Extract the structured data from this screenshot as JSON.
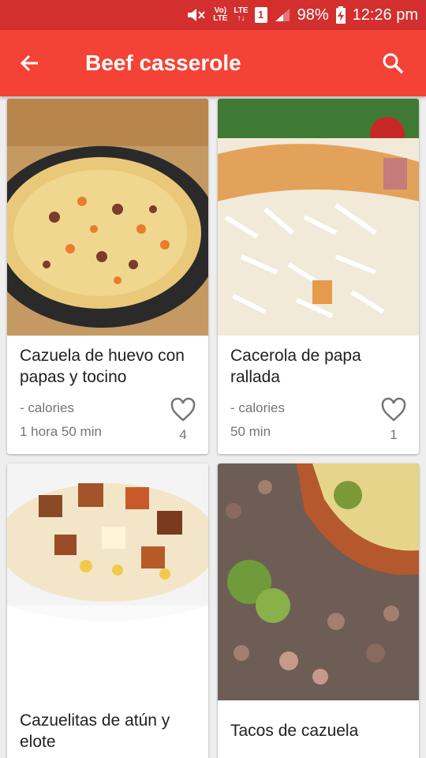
{
  "status_bar": {
    "volte_top": "Vo)",
    "volte_bottom": "LTE",
    "lte_top": "LTE",
    "lte_arrows": "↑↓",
    "sim": "1",
    "battery": "98%",
    "time": "12:26 pm"
  },
  "app_bar": {
    "title": "Beef casserole",
    "back_icon": "arrow-back-icon",
    "search_icon": "search-icon"
  },
  "recipes": [
    {
      "name": "Cazuela de huevo con papas y tocino",
      "calories": "- calories",
      "time": "1 hora 50 min",
      "likes": "4"
    },
    {
      "name": "Cacerola de papa rallada",
      "calories": "- calories",
      "time": "50 min",
      "likes": "1"
    },
    {
      "name": "Cazuelitas de atún y elote",
      "calories": "",
      "time": "",
      "likes": ""
    },
    {
      "name": "Tacos de cazuela",
      "calories": "",
      "time": "",
      "likes": ""
    }
  ],
  "colors": {
    "status_bar": "#d32f2f",
    "app_bar": "#f44336",
    "background": "#eeeeee"
  }
}
